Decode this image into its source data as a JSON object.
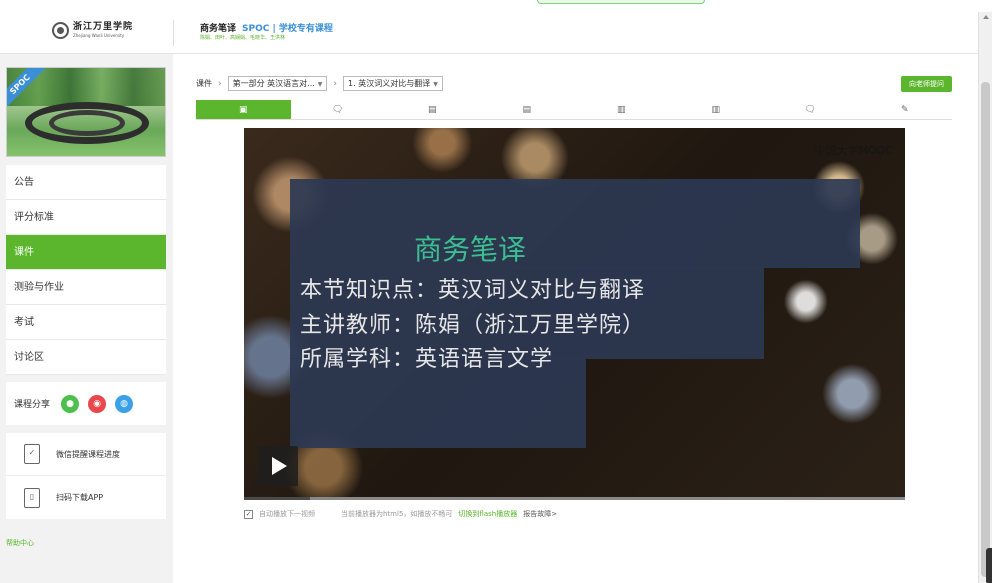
{
  "header": {
    "logo_cn": "浙江万里学院",
    "logo_en": "Zhejiang Wanli University",
    "course_name": "商务笔译",
    "course_badge": "SPOC | 学校专有课程",
    "teachers": "陈娟、田叶、高娴娟、毛晓华、王洪林"
  },
  "sidebar": {
    "cover_ribbon": "SPOC",
    "nav": [
      {
        "label": "公告",
        "active": false
      },
      {
        "label": "评分标准",
        "active": false
      },
      {
        "label": "课件",
        "active": true
      },
      {
        "label": "测验与作业",
        "active": false
      },
      {
        "label": "考试",
        "active": false
      },
      {
        "label": "讨论区",
        "active": false
      }
    ],
    "share_label": "课程分享",
    "share_icons": [
      {
        "name": "wechat-share-icon",
        "color": "#4cbf4c"
      },
      {
        "name": "weibo-share-icon",
        "color": "#e8474c"
      },
      {
        "name": "qq-share-icon",
        "color": "#3aa0e8"
      }
    ],
    "wechat_reminder": "微信提醒课程进度",
    "download_app": "扫码下载APP",
    "help": "帮助中心"
  },
  "breadcrumb": {
    "root": "课件",
    "section": "第一部分 英汉语言对...",
    "lesson": "1. 英汉词义对比与翻译"
  },
  "ask_teacher": "向老师提问",
  "tabs": [
    {
      "icon": "video-icon",
      "glyph": "▣",
      "active": true
    },
    {
      "icon": "discussion-icon",
      "glyph": "🗨",
      "active": false
    },
    {
      "icon": "document-icon",
      "glyph": "▤",
      "active": false
    },
    {
      "icon": "document-icon",
      "glyph": "▤",
      "active": false
    },
    {
      "icon": "text-icon",
      "glyph": "▥",
      "active": false
    },
    {
      "icon": "text-icon",
      "glyph": "▥",
      "active": false
    },
    {
      "icon": "discussion-icon",
      "glyph": "🗨",
      "active": false
    },
    {
      "icon": "edit-icon",
      "glyph": "✎",
      "active": false
    }
  ],
  "video": {
    "watermark": "中国大学MOOC",
    "title": "商务笔译",
    "line1": "本节知识点：英汉词义对比与翻译",
    "line2": "主讲教师：陈娟（浙江万里学院）",
    "line3": "所属学科：英语语言文学",
    "progress_fraction": 0.1
  },
  "video_footer": {
    "autoplay": "自动播放下一视频",
    "note": "当前播放器为html5，如播放不畅可",
    "switch_link": "切换到flash播放器",
    "report": "报告故障>"
  },
  "colors": {
    "accent": "#5bb62e",
    "link": "#3b8fd6"
  }
}
